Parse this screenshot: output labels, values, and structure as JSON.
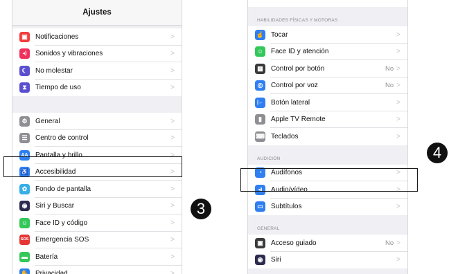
{
  "left": {
    "title": "Ajustes",
    "group1": [
      {
        "label": "Notificaciones",
        "icon": "notifications-icon",
        "color": "#f23d3d",
        "glyph": "▣"
      },
      {
        "label": "Sonidos y vibraciones",
        "icon": "speaker-icon",
        "color": "#f0315c",
        "glyph": "◂)"
      },
      {
        "label": "No molestar",
        "icon": "moon-icon",
        "color": "#5a4fd0",
        "glyph": "☾"
      },
      {
        "label": "Tiempo de uso",
        "icon": "hourglass-icon",
        "color": "#5a4fd0",
        "glyph": "⧗"
      }
    ],
    "group2": [
      {
        "label": "General",
        "icon": "gear-icon",
        "color": "#8e8e93",
        "glyph": "⚙"
      },
      {
        "label": "Centro de control",
        "icon": "toggles-icon",
        "color": "#8e8e93",
        "glyph": "☰"
      },
      {
        "label": "Pantalla y brillo",
        "icon": "text-size-icon",
        "color": "#2f7ff0",
        "glyph": "AA"
      },
      {
        "label": "Accesibilidad",
        "icon": "accessibility-icon",
        "color": "#2f7ff0",
        "glyph": "♿"
      },
      {
        "label": "Fondo de pantalla",
        "icon": "wallpaper-icon",
        "color": "#36aee6",
        "glyph": "✿"
      },
      {
        "label": "Siri y Buscar",
        "icon": "siri-icon",
        "color": "#2c2c50",
        "glyph": "◉"
      },
      {
        "label": "Face ID y código",
        "icon": "face-id-icon",
        "color": "#34c759",
        "glyph": "☺"
      },
      {
        "label": "Emergencia SOS",
        "icon": "sos-icon",
        "color": "#e63535",
        "glyph": "SOS"
      },
      {
        "label": "Batería",
        "icon": "battery-icon",
        "color": "#34c759",
        "glyph": "▬"
      },
      {
        "label": "Privacidad",
        "icon": "hand-icon",
        "color": "#2f7ff0",
        "glyph": "✋"
      }
    ]
  },
  "right": {
    "section_motor": "HABILIDADES FÍSICAS Y MOTORAS",
    "motor": [
      {
        "label": "Tocar",
        "icon": "hand-point-icon",
        "color": "#2f7ff0",
        "glyph": "☝",
        "value": ""
      },
      {
        "label": "Face ID y atención",
        "icon": "face-id-icon",
        "color": "#34c759",
        "glyph": "☺",
        "value": ""
      },
      {
        "label": "Control por botón",
        "icon": "switch-grid-icon",
        "color": "#3a3a3c",
        "glyph": "▦",
        "value": "No"
      },
      {
        "label": "Control por voz",
        "icon": "voice-control-icon",
        "color": "#2f7ff0",
        "glyph": "◎",
        "value": "No"
      },
      {
        "label": "Botón lateral",
        "icon": "side-button-icon",
        "color": "#2f7ff0",
        "glyph": "|←",
        "value": ""
      },
      {
        "label": "Apple TV Remote",
        "icon": "remote-icon",
        "color": "#8e8e93",
        "glyph": "▮",
        "value": ""
      },
      {
        "label": "Teclados",
        "icon": "keyboard-icon",
        "color": "#8e8e93",
        "glyph": "⌨",
        "value": ""
      }
    ],
    "section_hearing": "AUDICIÓN",
    "hearing": [
      {
        "label": "Audífonos",
        "icon": "ear-icon",
        "color": "#2f7ff0",
        "glyph": "◔",
        "value": ""
      },
      {
        "label": "Audio/vídeo",
        "icon": "audio-video-icon",
        "color": "#2f7ff0",
        "glyph": "◂)",
        "value": ""
      },
      {
        "label": "Subtítulos",
        "icon": "subtitles-icon",
        "color": "#2f7ff0",
        "glyph": "▭",
        "value": ""
      }
    ],
    "section_general": "GENERAL",
    "general": [
      {
        "label": "Acceso guiado",
        "icon": "lock-icon",
        "color": "#3a3a3c",
        "glyph": "▣",
        "value": "No"
      },
      {
        "label": "Siri",
        "icon": "siri-icon",
        "color": "#2c2c50",
        "glyph": "◉",
        "value": ""
      }
    ]
  },
  "steps": {
    "three": "3",
    "four": "4"
  },
  "chevron": ">"
}
